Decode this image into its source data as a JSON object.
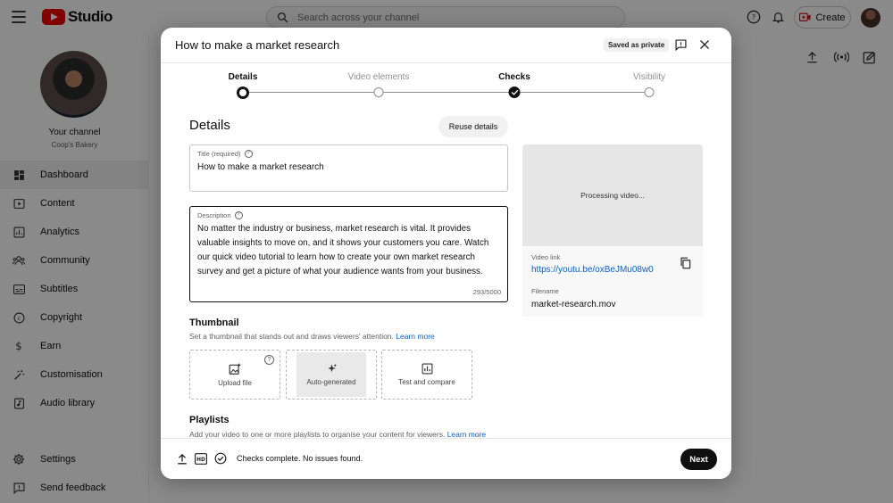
{
  "app": {
    "logo_text": "Studio",
    "search_placeholder": "Search across your channel",
    "create_label": "Create"
  },
  "channel": {
    "title": "Your channel",
    "name": "Coop's Bakery"
  },
  "sidebar": {
    "items": [
      {
        "label": "Dashboard",
        "icon": "dashboard-icon",
        "active": true
      },
      {
        "label": "Content",
        "icon": "content-icon"
      },
      {
        "label": "Analytics",
        "icon": "analytics-icon"
      },
      {
        "label": "Community",
        "icon": "community-icon"
      },
      {
        "label": "Subtitles",
        "icon": "subtitles-icon"
      },
      {
        "label": "Copyright",
        "icon": "copyright-icon"
      },
      {
        "label": "Earn",
        "icon": "earn-icon"
      },
      {
        "label": "Customisation",
        "icon": "customisation-icon"
      },
      {
        "label": "Audio library",
        "icon": "audio-library-icon"
      }
    ],
    "bottom_items": [
      {
        "label": "Settings",
        "icon": "settings-icon"
      },
      {
        "label": "Send feedback",
        "icon": "feedback-icon"
      }
    ]
  },
  "dialog": {
    "title": "How to make a market research",
    "saved_badge": "Saved as private",
    "steps": [
      {
        "label": "Details",
        "state": "current"
      },
      {
        "label": "Video elements",
        "state": "pending"
      },
      {
        "label": "Checks",
        "state": "done"
      },
      {
        "label": "Visibility",
        "state": "pending"
      }
    ],
    "section_title": "Details",
    "reuse_label": "Reuse details",
    "title_field": {
      "label": "Title (required)",
      "value": "How to make a market research"
    },
    "description_field": {
      "label": "Description",
      "value": "No matter the industry or business, market research is vital. It provides valuable insights to move on, and it shows your customers you care. Watch our quick video tutorial to learn how to create your own market research survey and get a picture of what your audience wants from your business.",
      "counter": "293/5000"
    },
    "preview": {
      "processing": "Processing video...",
      "video_link_label": "Video link",
      "video_link": "https://youtu.be/oxBeJMu08w0",
      "filename_label": "Filename",
      "filename": "market-research.mov"
    },
    "thumbnail": {
      "title": "Thumbnail",
      "desc": "Set a thumbnail that stands out and draws viewers' attention.",
      "learn_more": "Learn more",
      "options": [
        {
          "label": "Upload file",
          "icon": "upload-image-icon"
        },
        {
          "label": "Auto-generated",
          "icon": "sparkle-icon"
        },
        {
          "label": "Test and compare",
          "icon": "chart-icon"
        }
      ]
    },
    "playlists": {
      "title": "Playlists",
      "desc": "Add your video to one or more playlists to organise your content for viewers.",
      "learn_more": "Learn more"
    },
    "footer": {
      "status": "Checks complete. No issues found.",
      "next_label": "Next",
      "hd_badge": "HD"
    }
  },
  "colors": {
    "accent_link": "#065fd4",
    "logo_red": "#ee0000",
    "primary_button": "#0f0f0f"
  }
}
